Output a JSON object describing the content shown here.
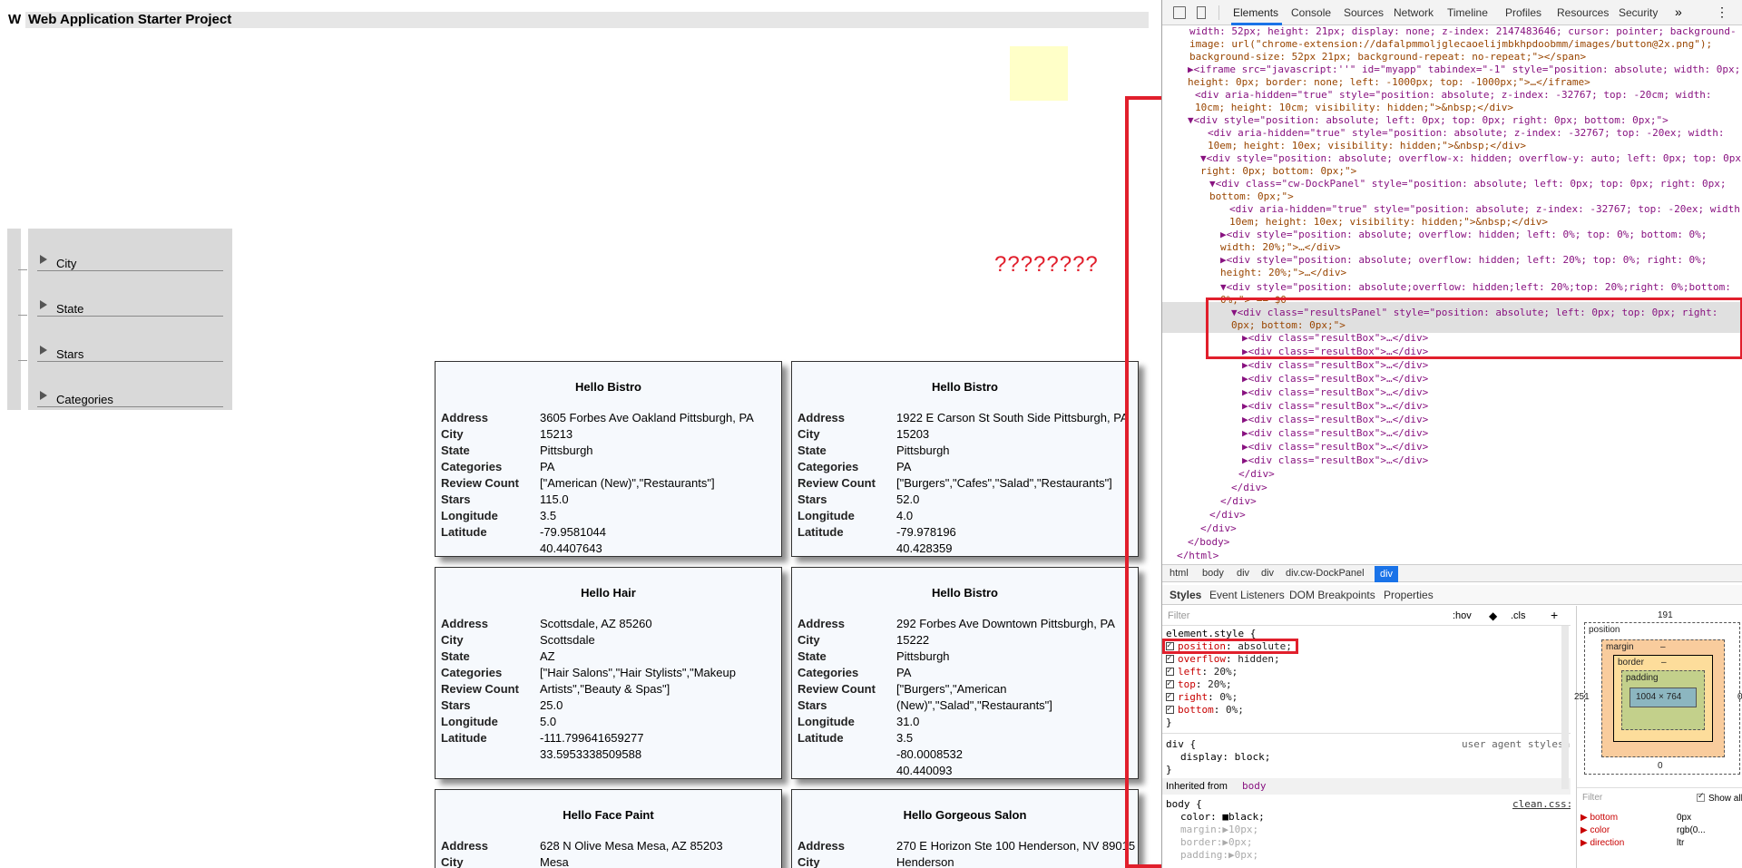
{
  "app": {
    "letter": "W",
    "title": "Web Application Starter Project",
    "filters": [
      "City",
      "State",
      "Stars",
      "Categories"
    ],
    "question_marks": "????????",
    "cards": [
      {
        "title": "Hello Bistro",
        "values": [
          "3605 Forbes Ave Oakland Pittsburgh, PA",
          "15213",
          "Pittsburgh",
          "PA",
          "[\"American (New)\",\"Restaurants\"]",
          "115.0",
          "3.5",
          "-79.9581044",
          "40.4407643"
        ]
      },
      {
        "title": "Hello Bistro",
        "values": [
          "1922 E Carson St South Side Pittsburgh, PA",
          "15203",
          "Pittsburgh",
          "PA",
          "[\"Burgers\",\"Cafes\",\"Salad\",\"Restaurants\"]",
          "52.0",
          "4.0",
          "-79.978196",
          "40.428359"
        ]
      },
      {
        "title": "Hello Hair",
        "values": [
          "Scottsdale, AZ 85260",
          "Scottsdale",
          "AZ",
          "[\"Hair Salons\",\"Hair Stylists\",\"Makeup Artists\",\"Beauty & Spas\"]",
          "25.0",
          "5.0",
          "-111.799641659277",
          "33.5953338509588"
        ]
      },
      {
        "title": "Hello Bistro",
        "values": [
          "292 Forbes Ave Downtown Pittsburgh, PA",
          "15222",
          "Pittsburgh",
          "PA",
          "[\"Burgers\",\"American (New)\",\"Salad\",\"Restaurants\"]",
          "31.0",
          "3.5",
          "-80.0008532",
          "40.440093"
        ]
      },
      {
        "title": "Hello Face Paint",
        "values": [
          "628 N Olive Mesa Mesa, AZ 85203",
          "Mesa"
        ]
      },
      {
        "title": "Hello Gorgeous Salon",
        "values": [
          "270 E Horizon Ste 100 Henderson, NV 89015",
          "Henderson"
        ]
      }
    ],
    "card_labels": [
      "Address",
      "City",
      "State",
      "Categories",
      "Review Count",
      "Stars",
      "Longitude",
      "Latitude"
    ]
  },
  "devtools": {
    "tabs": [
      "Elements",
      "Console",
      "Sources",
      "Network",
      "Timeline",
      "Profiles",
      "Resources",
      "Security"
    ],
    "overflow": "»",
    "kebab": "⋮",
    "dom_lines": [
      "width: 52px; height: 21px; display: none; z-index: 2147483646; cursor: pointer; background-",
      "image: url(\"chrome-extension://dafalpmmoljglecaoelijmbkhpdoobmm/images/button@2x.png\");",
      "background-size: 52px 21px; background-repeat: no-repeat;\"></span>",
      "▶<iframe src=\"javascript:''\" id=\"myapp\" tabindex=\"-1\" style=\"position: absolute; width: 0px;",
      "height: 0px; border: none; left: -1000px; top: -1000px;\">…</iframe>",
      "<div aria-hidden=\"true\" style=\"position: absolute; z-index: -32767; top: -20cm; width:",
      "10cm; height: 10cm; visibility: hidden;\">&nbsp;</div>",
      "▼<div style=\"position: absolute; left: 0px; top: 0px; right: 0px; bottom: 0px;\">",
      "<div aria-hidden=\"true\" style=\"position: absolute; z-index: -32767; top: -20ex; width:",
      "10em; height: 10ex; visibility: hidden;\">&nbsp;</div>",
      "▼<div style=\"position: absolute; overflow-x: hidden; overflow-y: auto; left: 0px; top: 0px;",
      "right: 0px; bottom: 0px;\">",
      "▼<div class=\"cw-DockPanel\" style=\"position: absolute; left: 0px; top: 0px; right: 0px;",
      "bottom: 0px;\">",
      "<div aria-hidden=\"true\" style=\"position: absolute; z-index: -32767; top: -20ex; width:",
      "10em; height: 10ex; visibility: hidden;\">&nbsp;</div>",
      "▶<div style=\"position: absolute; overflow: hidden; left: 0%; top: 0%; bottom: 0%;",
      "width: 20%;\">…</div>",
      "▶<div style=\"position: absolute; overflow: hidden; left: 20%; top: 0%; right: 0%;",
      "height: 20%;\">…</div>",
      "▼<div style=\"position: absolute;overflow: hidden;left: 20%;top: 20%;right: 0%;bottom:",
      "0%;\"> == $0",
      "▼<div class=\"resultsPanel\" style=\"position: absolute; left: 0px; top: 0px; right:",
      "0px; bottom: 0px;\">",
      "▶<div class=\"resultBox\">…</div>",
      "▶<div class=\"resultBox\">…</div>",
      "▶<div class=\"resultBox\">…</div>",
      "▶<div class=\"resultBox\">…</div>",
      "▶<div class=\"resultBox\">…</div>",
      "▶<div class=\"resultBox\">…</div>",
      "▶<div class=\"resultBox\">…</div>",
      "▶<div class=\"resultBox\">…</div>",
      "▶<div class=\"resultBox\">…</div>",
      "▶<div class=\"resultBox\">…</div>",
      "</div>",
      "</div>",
      "</div>",
      "</div>",
      "</div>",
      "</body>",
      "</html>"
    ],
    "breadcrumb": [
      "html",
      "body",
      "div",
      "div",
      "div.cw-DockPanel",
      "div"
    ],
    "style_tabs": [
      "Styles",
      "Event Listeners",
      "DOM Breakpoints",
      "Properties"
    ],
    "filter_placeholder": "Filter",
    "hov": ":hov",
    "cls": ".cls",
    "plus": "+",
    "styles": {
      "element_style": "element.style {",
      "props": [
        {
          "name": "position",
          "value": "absolute;"
        },
        {
          "name": "overflow",
          "value": "hidden;"
        },
        {
          "name": "left",
          "value": "20%;"
        },
        {
          "name": "top",
          "value": "20%;"
        },
        {
          "name": "right",
          "value": "0%;"
        },
        {
          "name": "bottom",
          "value": "0%;"
        }
      ],
      "close": "}",
      "div_rule": "div {",
      "div_source": "user agent stylesheet",
      "div_prop": "display: block;",
      "inherited": "Inherited from",
      "inherited_tag": "body",
      "body_rule": "body {",
      "body_source": "clean.css:13",
      "body_props": [
        "color: ■black;",
        "margin:▶10px;",
        "border:▶0px;",
        "padding:▶0px;"
      ]
    },
    "box_model": {
      "position_label": "position",
      "position_top": "191",
      "margin_label": "margin",
      "border_label": "border",
      "padding_label": "padding",
      "dash": "–",
      "content": "1004 × 764",
      "left_val": "251",
      "right_val": "0",
      "bottom_val": "0"
    },
    "computed": {
      "filter": "Filter",
      "show_all": "Show all",
      "items": [
        {
          "name": "bottom",
          "value": "0px"
        },
        {
          "name": "color",
          "value": "rgb(0..."
        },
        {
          "name": "direction",
          "value": "ltr"
        }
      ]
    }
  }
}
